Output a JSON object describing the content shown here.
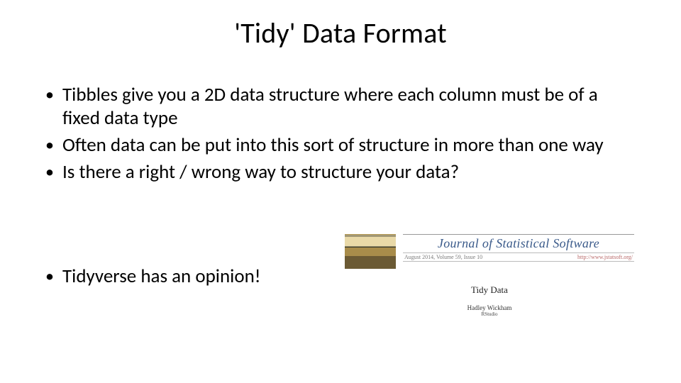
{
  "title": "'Tidy' Data Format",
  "bullets": [
    "Tibbles give you a 2D data structure where each column must be of a fixed data type",
    "Often data can be put into this sort of structure in more than one way",
    "Is there a right / wrong way to structure your data?"
  ],
  "final_bullet": "Tidyverse has an opinion!",
  "paper": {
    "journal": "Journal of Statistical Software",
    "issue_line": "August 2014, Volume 59, Issue 10",
    "url_text": "http://www.jstatsoft.org/",
    "title": "Tidy Data",
    "author": "Hadley Wickham",
    "org": "RStudio"
  }
}
